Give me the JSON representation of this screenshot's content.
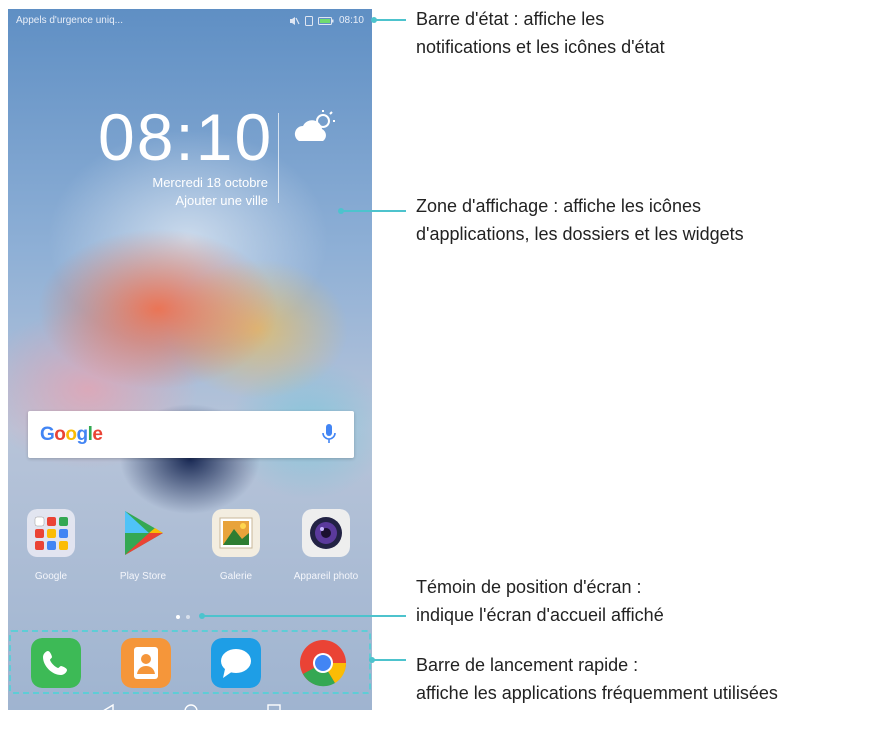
{
  "status_bar": {
    "carrier_text": "Appels d'urgence uniq...",
    "time": "08:10",
    "icons": [
      "mute-icon",
      "sim-icon",
      "battery-icon"
    ]
  },
  "lock_widget": {
    "clock": "08:10",
    "date": "Mercredi 18 octobre",
    "city_link": "Ajouter une ville",
    "weather_icon": "partly-cloudy-icon"
  },
  "search_bar": {
    "logo": "Google",
    "mic_icon": "microphone-icon"
  },
  "home_apps": [
    {
      "label": "Google",
      "icon": "google-folder-icon"
    },
    {
      "label": "Play Store",
      "icon": "play-store-icon"
    },
    {
      "label": "Galerie",
      "icon": "gallery-icon"
    },
    {
      "label": "Appareil photo",
      "icon": "camera-icon"
    }
  ],
  "page_indicator": {
    "count": 2,
    "active": 1
  },
  "dock": [
    {
      "icon": "phone-icon"
    },
    {
      "icon": "contacts-icon"
    },
    {
      "icon": "messages-icon"
    },
    {
      "icon": "chrome-icon"
    }
  ],
  "nav_bar": [
    "back-icon",
    "home-icon",
    "recents-icon"
  ],
  "callouts": {
    "status_bar": [
      "Barre d'état : affiche les",
      "notifications et les icônes d'état"
    ],
    "display_area": [
      "Zone d'affichage : affiche les icônes",
      "d'applications, les dossiers et les widgets"
    ],
    "screen_indicator": [
      "Témoin de position d'écran :",
      "indique l'écran d'accueil affiché"
    ],
    "launch_bar": [
      "Barre de lancement rapide :",
      "affiche les applications fréquemment utilisées"
    ]
  },
  "colors": {
    "accent": "#4dc3cd"
  }
}
